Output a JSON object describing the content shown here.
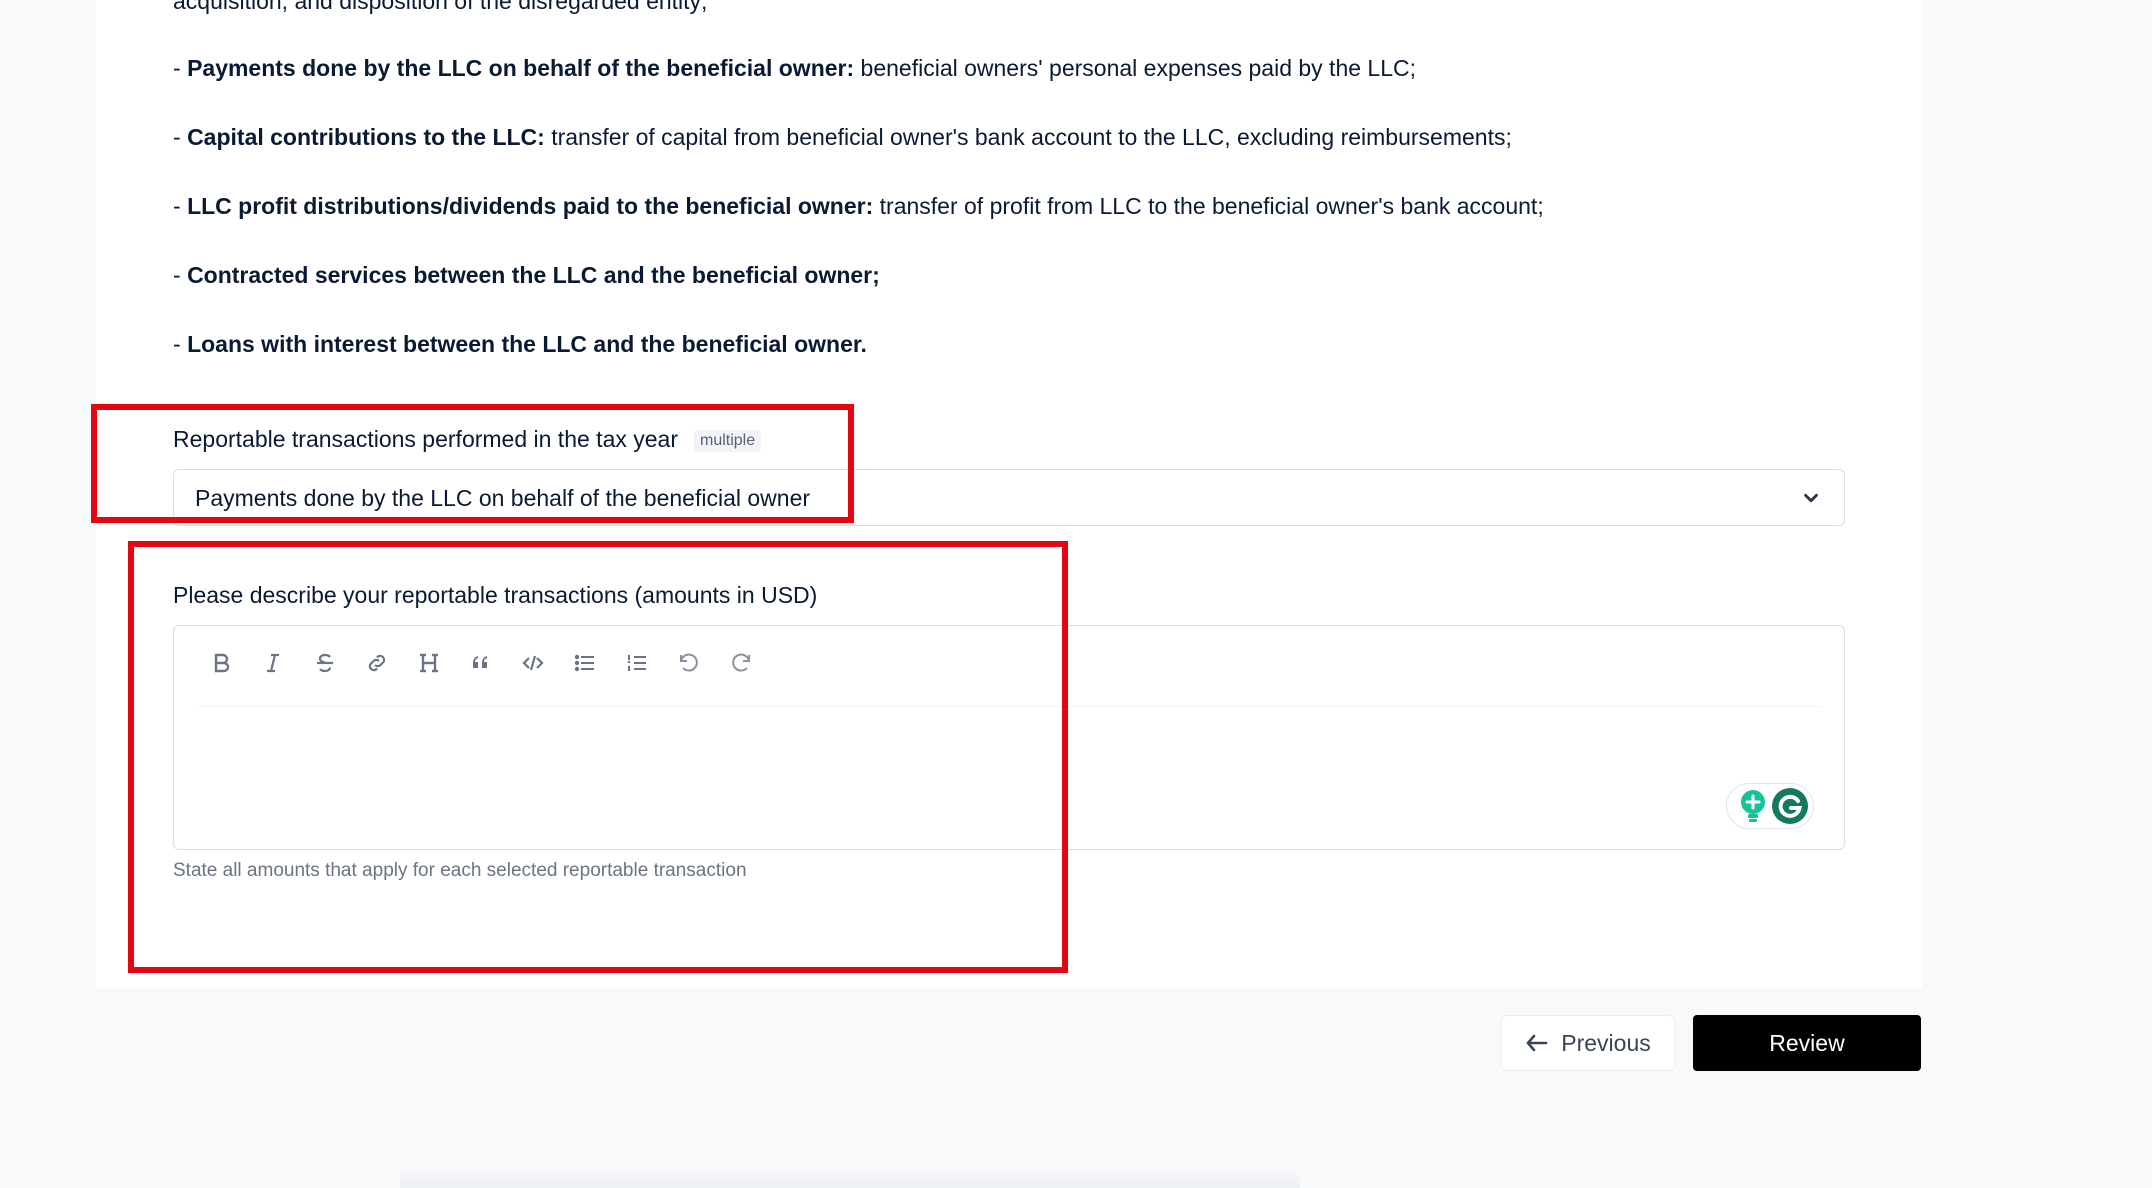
{
  "intro_cut": "acquisition, and disposition of the disregarded entity;",
  "items": [
    {
      "prefix": "- ",
      "bold": "Payments done by the LLC on behalf of the beneficial owner:",
      "rest": " beneficial owners' personal expenses paid by the LLC;"
    },
    {
      "prefix": "- ",
      "bold": "Capital contributions to the LLC:",
      "rest": " transfer of capital from beneficial owner's bank account to the LLC, excluding reimbursements;"
    },
    {
      "prefix": "- ",
      "bold": "LLC profit distributions/dividends paid to the beneficial owner:",
      "rest": " transfer of profit from LLC to the beneficial owner's bank account;"
    },
    {
      "prefix": "- ",
      "bold": "Contracted services between the LLC and the beneficial owner;",
      "rest": ""
    },
    {
      "prefix": "- ",
      "bold": "Loans with interest between the LLC and the beneficial owner.",
      "rest": ""
    }
  ],
  "transactions_field": {
    "label": "Reportable transactions performed in the tax year",
    "tag": "multiple",
    "selected_value": "Payments done by the LLC on behalf of the beneficial owner"
  },
  "describe_field": {
    "label": "Please describe your reportable transactions (amounts in USD)",
    "help_text": "State all amounts that apply for each selected reportable transaction",
    "toolbar": [
      "bold-icon",
      "italic-icon",
      "strikethrough-icon",
      "link-icon",
      "heading-icon",
      "quote-icon",
      "code-icon",
      "bullet-list-icon",
      "ordered-list-icon",
      "undo-icon",
      "redo-icon"
    ]
  },
  "buttons": {
    "previous": "Previous",
    "review": "Review"
  },
  "colors": {
    "highlight": "#e30613",
    "primary_button": "#000000",
    "grammarly": "#15c39a"
  }
}
